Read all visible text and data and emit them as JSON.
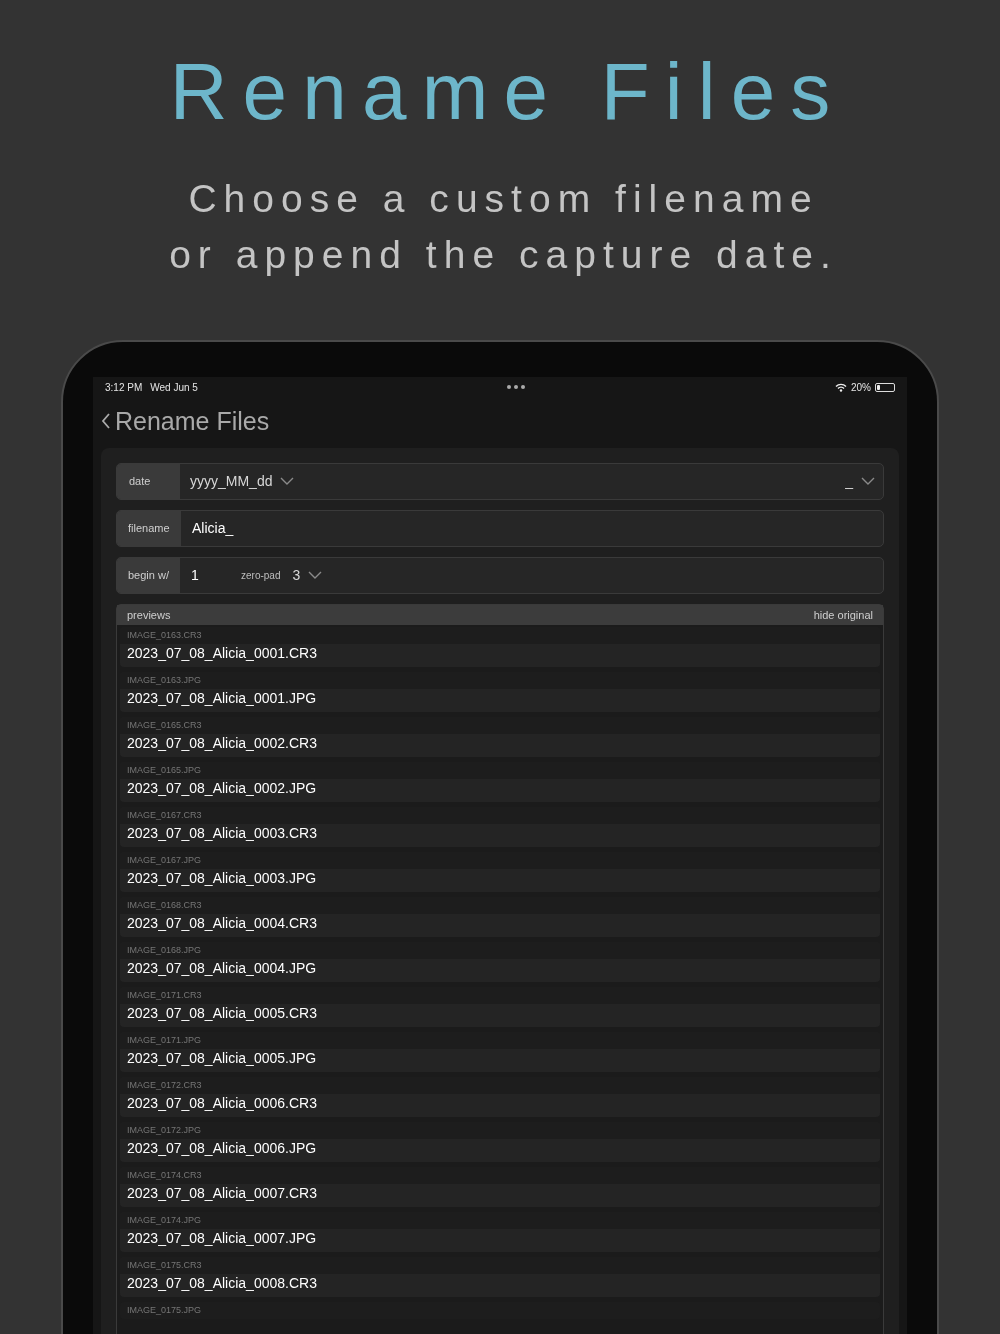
{
  "headline": "Rename Files",
  "subtitle_lines": [
    "Choose a custom filename",
    "or append the capture date."
  ],
  "status_bar": {
    "time": "3:12 PM",
    "date": "Wed Jun 5",
    "battery": "20%"
  },
  "nav": {
    "title": "Rename Files"
  },
  "date_row": {
    "label": "date",
    "format": "yyyy_MM_dd",
    "separator": "_"
  },
  "filename_row": {
    "label": "filename",
    "value": "Alicia_"
  },
  "begin_row": {
    "label": "begin w/",
    "value": "1",
    "pad_label": "zero-pad",
    "pad_value": "3"
  },
  "previews": {
    "title": "previews",
    "toggle": "hide original",
    "items": [
      {
        "original": "IMAGE_0163.CR3",
        "renamed": "2023_07_08_Alicia_0001.CR3"
      },
      {
        "original": "IMAGE_0163.JPG",
        "renamed": "2023_07_08_Alicia_0001.JPG"
      },
      {
        "original": "IMAGE_0165.CR3",
        "renamed": "2023_07_08_Alicia_0002.CR3"
      },
      {
        "original": "IMAGE_0165.JPG",
        "renamed": "2023_07_08_Alicia_0002.JPG"
      },
      {
        "original": "IMAGE_0167.CR3",
        "renamed": "2023_07_08_Alicia_0003.CR3"
      },
      {
        "original": "IMAGE_0167.JPG",
        "renamed": "2023_07_08_Alicia_0003.JPG"
      },
      {
        "original": "IMAGE_0168.CR3",
        "renamed": "2023_07_08_Alicia_0004.CR3"
      },
      {
        "original": "IMAGE_0168.JPG",
        "renamed": "2023_07_08_Alicia_0004.JPG"
      },
      {
        "original": "IMAGE_0171.CR3",
        "renamed": "2023_07_08_Alicia_0005.CR3"
      },
      {
        "original": "IMAGE_0171.JPG",
        "renamed": "2023_07_08_Alicia_0005.JPG"
      },
      {
        "original": "IMAGE_0172.CR3",
        "renamed": "2023_07_08_Alicia_0006.CR3"
      },
      {
        "original": "IMAGE_0172.JPG",
        "renamed": "2023_07_08_Alicia_0006.JPG"
      },
      {
        "original": "IMAGE_0174.CR3",
        "renamed": "2023_07_08_Alicia_0007.CR3"
      },
      {
        "original": "IMAGE_0174.JPG",
        "renamed": "2023_07_08_Alicia_0007.JPG"
      },
      {
        "original": "IMAGE_0175.CR3",
        "renamed": "2023_07_08_Alicia_0008.CR3"
      },
      {
        "original": "IMAGE_0175.JPG"
      }
    ]
  }
}
